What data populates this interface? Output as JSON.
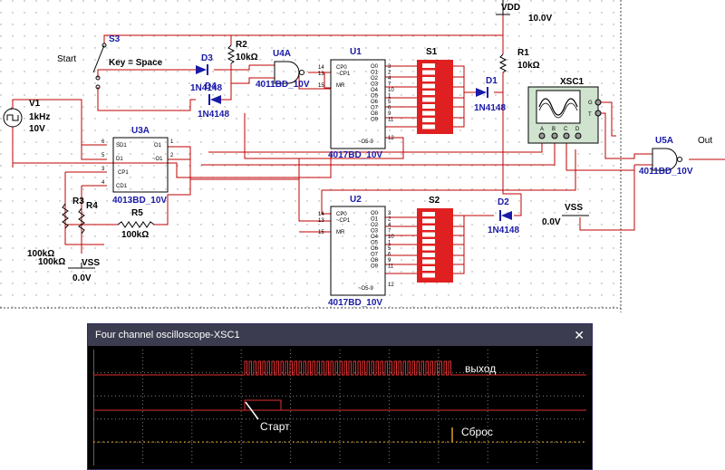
{
  "schematic": {
    "power": {
      "vdd_label": "VDD",
      "vdd_value": "10.0V",
      "vss_label": "VSS",
      "vss_value": "0.0V",
      "vss2_label": "VSS",
      "vss2_value": "0.0V"
    },
    "switch": {
      "ref": "S3",
      "start_text": "Start",
      "key_text": "Key = Space"
    },
    "source": {
      "ref": "V1",
      "freq": "1kHz",
      "volt": "10V"
    },
    "resistors": {
      "r1": {
        "ref": "R1",
        "value": "10kΩ"
      },
      "r2": {
        "ref": "R2",
        "value": "10kΩ"
      },
      "r3": {
        "ref": "R3",
        "value": "100kΩ"
      },
      "r4": {
        "ref": "R4",
        "value": "100kΩ"
      },
      "r5": {
        "ref": "R5",
        "value": "100kΩ"
      }
    },
    "diodes": {
      "d1": {
        "ref": "D1",
        "part": "1N4148"
      },
      "d2": {
        "ref": "D2",
        "part": "1N4148"
      },
      "d3": {
        "ref": "D3",
        "part": "1N4148"
      },
      "d4": {
        "ref": "D4",
        "part": "1N4148"
      }
    },
    "gates": {
      "u4a": {
        "ref": "U4A",
        "part": "4011BD_10V"
      },
      "u5a": {
        "ref": "U5A",
        "part": "4011BD_10V",
        "out": "Out"
      }
    },
    "flipflop": {
      "ref": "U3A",
      "part": "4013BD_10V",
      "pins": [
        "SD1",
        "D1",
        "CP1",
        "CD1",
        "O1",
        "~O1"
      ],
      "pin_nums": [
        "6",
        "5",
        "3",
        "4",
        "1",
        "2"
      ]
    },
    "counters": {
      "u1": {
        "ref": "U1",
        "part": "4017BD_10V"
      },
      "u2": {
        "ref": "U2",
        "part": "4017BD_10V"
      },
      "left_pins": [
        "CP0",
        "~CP1",
        "MR"
      ],
      "left_nums": [
        "14",
        "13",
        "15"
      ],
      "outputs": [
        "O0",
        "O1",
        "O2",
        "O3",
        "O4",
        "O5",
        "O6",
        "O7",
        "O8",
        "O9"
      ],
      "output_nums": [
        "3",
        "2",
        "4",
        "7",
        "10",
        "1",
        "5",
        "6",
        "9",
        "11"
      ],
      "carry": "~O5-9",
      "carry_num": "12"
    },
    "dip_switches": {
      "s1": "S1",
      "s2": "S2"
    },
    "scope": {
      "ref": "XSC1",
      "channels": [
        "A",
        "B",
        "C",
        "D"
      ],
      "g": "G",
      "t": "T"
    }
  },
  "oscilloscope": {
    "title": "Four channel oscilloscope-XSC1",
    "close": "✕",
    "labels": {
      "output": "выход",
      "start": "Старт",
      "reset": "Сброс"
    },
    "colors": {
      "trace_a": "#e03030",
      "trace_c": "#e0a020",
      "grid": "#808080",
      "titlebar": "#3c3c50"
    }
  }
}
